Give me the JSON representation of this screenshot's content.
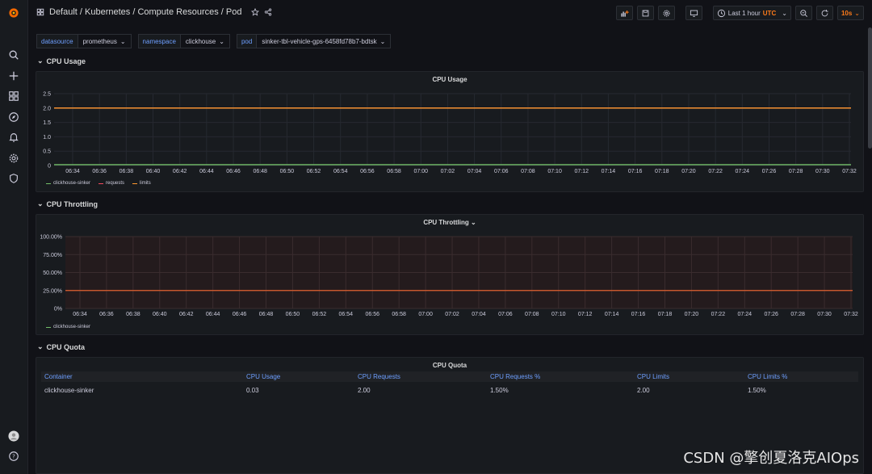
{
  "breadcrumb": {
    "path": "Default / Kubernetes / Compute Resources / Pod"
  },
  "toolbar": {
    "time_range": "Last 1 hour",
    "timezone": "UTC",
    "refresh": "10s"
  },
  "variables": [
    {
      "label": "datasource",
      "value": "prometheus"
    },
    {
      "label": "namespace",
      "value": "clickhouse"
    },
    {
      "label": "pod",
      "value": "sinker-tbl-vehicle-gps-6458fd78b7-bdtsk"
    }
  ],
  "rows": {
    "cpu_usage": "CPU Usage",
    "cpu_throttling": "CPU Throttling",
    "cpu_quota": "CPU Quota"
  },
  "time_ticks": [
    "06:34",
    "06:36",
    "06:38",
    "06:40",
    "06:42",
    "06:44",
    "06:46",
    "06:48",
    "06:50",
    "06:52",
    "06:54",
    "06:56",
    "06:58",
    "07:00",
    "07:02",
    "07:04",
    "07:06",
    "07:08",
    "07:10",
    "07:12",
    "07:14",
    "07:16",
    "07:18",
    "07:20",
    "07:22",
    "07:24",
    "07:26",
    "07:28",
    "07:30",
    "07:32"
  ],
  "chart_data": [
    {
      "type": "line",
      "title": "CPU Usage",
      "x": [
        "06:34",
        "06:36",
        "06:38",
        "06:40",
        "06:42",
        "06:44",
        "06:46",
        "06:48",
        "06:50",
        "06:52",
        "06:54",
        "06:56",
        "06:58",
        "07:00",
        "07:02",
        "07:04",
        "07:06",
        "07:08",
        "07:10",
        "07:12",
        "07:14",
        "07:16",
        "07:18",
        "07:20",
        "07:22",
        "07:24",
        "07:26",
        "07:28",
        "07:30",
        "07:32"
      ],
      "yticks": [
        "0",
        "0.5",
        "1.0",
        "1.5",
        "2.0",
        "2.5"
      ],
      "ylim": [
        0,
        2.5
      ],
      "series": [
        {
          "name": "clickhouse-sinker",
          "value": 0.03,
          "color": "#73bf69"
        },
        {
          "name": "requests",
          "value": 2.0,
          "color": "#f2495c"
        },
        {
          "name": "limits",
          "value": 2.0,
          "color": "#ff9830"
        }
      ]
    },
    {
      "type": "line",
      "title": "CPU Throttling",
      "x": [
        "06:34",
        "06:36",
        "06:38",
        "06:40",
        "06:42",
        "06:44",
        "06:46",
        "06:48",
        "06:50",
        "06:52",
        "06:54",
        "06:56",
        "06:58",
        "07:00",
        "07:02",
        "07:04",
        "07:06",
        "07:08",
        "07:10",
        "07:12",
        "07:14",
        "07:16",
        "07:18",
        "07:20",
        "07:22",
        "07:24",
        "07:26",
        "07:28",
        "07:30",
        "07:32"
      ],
      "yticks": [
        "0%",
        "25.00%",
        "50.00%",
        "75.00%",
        "100.00%"
      ],
      "ylim": [
        0,
        100
      ],
      "threshold": 25,
      "series": [
        {
          "name": "clickhouse-sinker",
          "color": "#73bf69"
        }
      ]
    },
    {
      "type": "table",
      "title": "CPU Quota",
      "columns": [
        "Container",
        "CPU Usage",
        "CPU Requests",
        "CPU Requests %",
        "CPU Limits",
        "CPU Limits %"
      ],
      "rows": [
        [
          "clickhouse-sinker",
          "0.03",
          "2.00",
          "1.50%",
          "2.00",
          "1.50%"
        ]
      ]
    }
  ],
  "watermark": "CSDN @擎创夏洛克AIOps"
}
